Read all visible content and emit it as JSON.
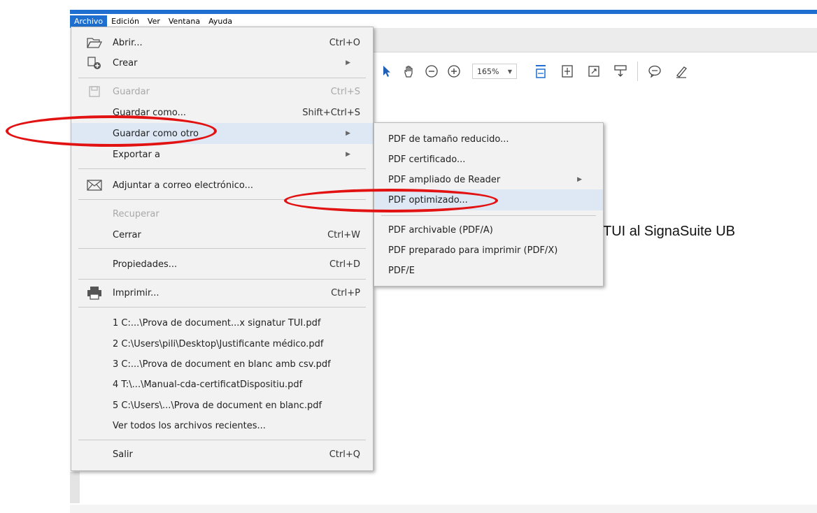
{
  "menubar": {
    "items": [
      "Archivo",
      "Edición",
      "Ver",
      "Ventana",
      "Ayuda"
    ]
  },
  "toolbar": {
    "zoom_value": "165%",
    "icons": [
      "select-arrow-icon",
      "hand-icon",
      "zoom-out-icon",
      "zoom-in-icon",
      "fit-width-icon",
      "fit-page-icon",
      "fullscreen-icon",
      "scroll-mode-icon",
      "comment-icon",
      "highlight-pen-icon"
    ]
  },
  "document": {
    "visible_text": "TUI al SignaSuite UB"
  },
  "file_menu": {
    "open": {
      "label": "Abrir...",
      "shortcut": "Ctrl+O"
    },
    "create": {
      "label": "Crear"
    },
    "save": {
      "label": "Guardar",
      "shortcut": "Ctrl+S"
    },
    "save_as": {
      "label": "Guardar como...",
      "shortcut": "Shift+Ctrl+S"
    },
    "save_as_other": {
      "label": "Guardar como otro"
    },
    "export": {
      "label": "Exportar a"
    },
    "attach_email": {
      "label": "Adjuntar a correo electrónico..."
    },
    "recover": {
      "label": "Recuperar"
    },
    "close": {
      "label": "Cerrar",
      "shortcut": "Ctrl+W"
    },
    "properties": {
      "label": "Propiedades...",
      "shortcut": "Ctrl+D"
    },
    "print": {
      "label": "Imprimir...",
      "shortcut": "Ctrl+P"
    },
    "recent": [
      "1 C:...\\Prova de document...x signatur TUI.pdf",
      "2 C:\\Users\\pili\\Desktop\\Justificante médico.pdf",
      "3 C:...\\Prova de document en blanc amb csv.pdf",
      "4 T:\\...\\Manual-cda-certificatDispositiu.pdf",
      "5 C:\\Users\\...\\Prova de document en blanc.pdf"
    ],
    "view_all_recent": {
      "label": "Ver todos los archivos recientes..."
    },
    "exit": {
      "label": "Salir",
      "shortcut": "Ctrl+Q"
    }
  },
  "submenu": {
    "items": [
      "PDF de tamaño reducido...",
      "PDF certificado...",
      "PDF ampliado de Reader",
      "PDF optimizado...",
      "PDF archivable (PDF/A)",
      "PDF preparado para imprimir (PDF/X)",
      "PDF/E"
    ]
  },
  "colors": {
    "menu_accent": "#1e6fd0",
    "highlight_row": "#dde8f4",
    "annotation_red": "#e31212"
  }
}
